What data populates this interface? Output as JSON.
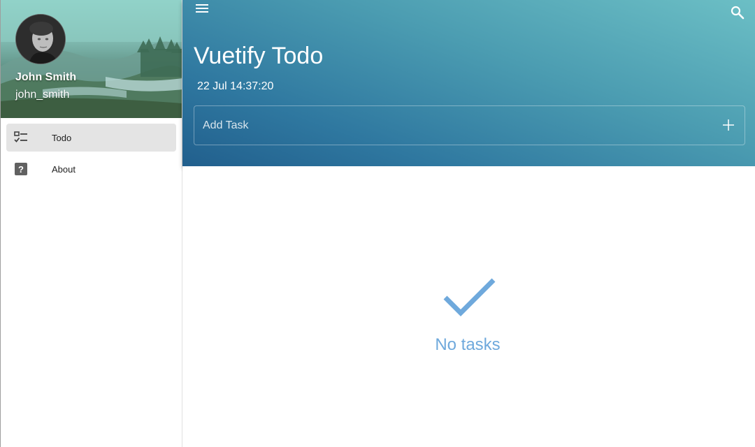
{
  "user": {
    "name": "John Smith",
    "handle": "john_smith"
  },
  "nav": {
    "items": [
      {
        "label": "Todo",
        "icon": "checklist-icon",
        "active": true
      },
      {
        "label": "About",
        "icon": "help-box-icon",
        "active": false
      }
    ]
  },
  "header": {
    "title": "Vuetify Todo",
    "datetime": "22 Jul 14:37:20",
    "add_task_placeholder": "Add Task",
    "add_task_value": ""
  },
  "main": {
    "empty_message": "No tasks"
  },
  "colors": {
    "accent": "#6fa9dc",
    "header_start": "#6cbfc5",
    "header_end": "#215f8d",
    "active_nav": "#e4e4e4"
  }
}
